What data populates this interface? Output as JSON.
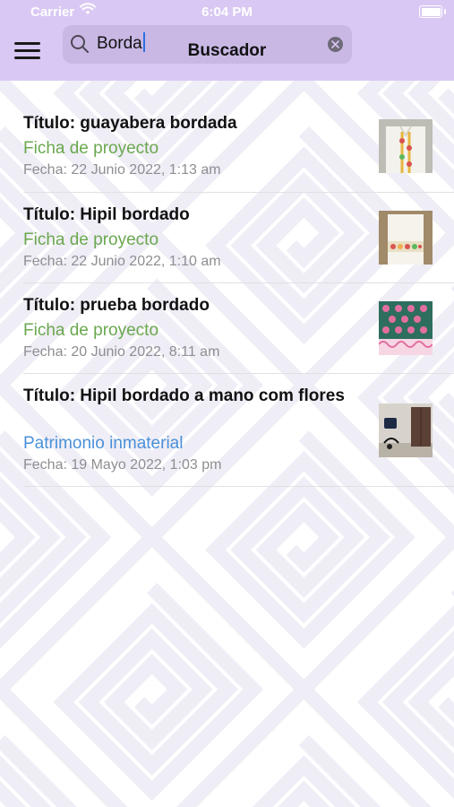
{
  "status_bar": {
    "carrier": "Carrier",
    "time": "6:04 PM",
    "battery_level": 1.0
  },
  "header": {
    "title": "Buscador",
    "search": {
      "value": "Borda"
    },
    "menu_icon": "hamburger-menu-icon",
    "clear_icon": "clear-circle-icon"
  },
  "colors": {
    "header_bg": "#d9c8f3",
    "search_bg": "#c9b8e4",
    "ficha": "#6aa84f",
    "patrimonio": "#4a90d9",
    "date": "#8e8e93",
    "pattern": "#efedf5"
  },
  "results": [
    {
      "title": "Título: guayabera bordada",
      "category": "Ficha de proyecto",
      "date": "Fecha: 22 Junio 2022, 1:13 am",
      "thumbnail": "guayabera-image"
    },
    {
      "title": "Título: Hipil bordado",
      "category": "Ficha de proyecto",
      "date": "Fecha: 22 Junio 2022, 1:10 am",
      "thumbnail": "hipil-image"
    },
    {
      "title": "Título: prueba bordado",
      "category": "Ficha de proyecto",
      "date": "Fecha: 20 Junio 2022, 8:11 am",
      "thumbnail": "embroidery-pattern-image"
    },
    {
      "title": "Título: Hipil bordado a mano com flores",
      "category": "Patrimonio inmaterial",
      "date": "Fecha: 19 Mayo 2022, 1:03 pm",
      "thumbnail": "room-image"
    }
  ]
}
